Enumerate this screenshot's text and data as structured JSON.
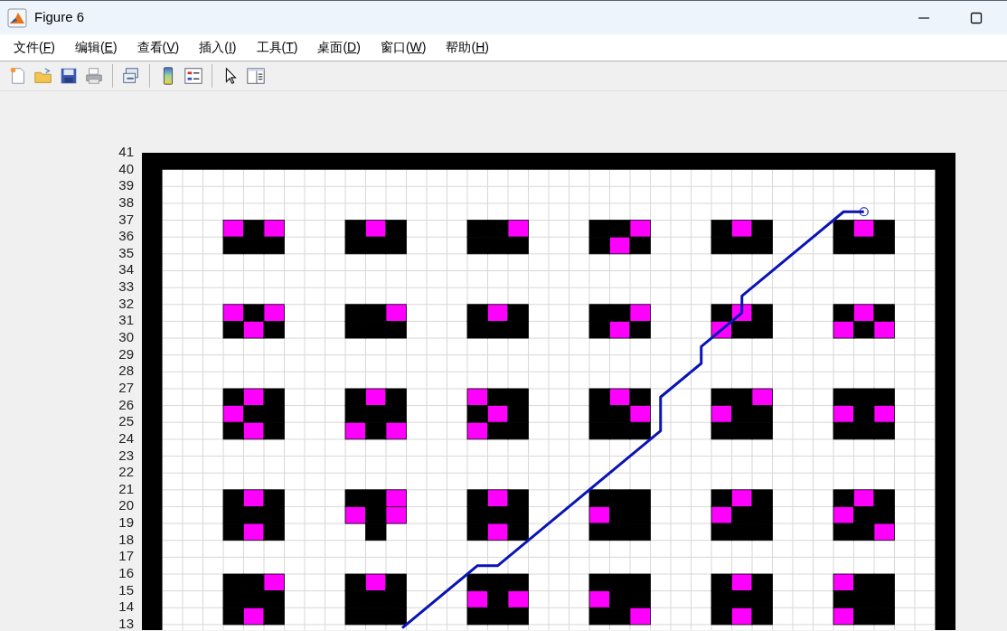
{
  "window": {
    "title": "Figure 6"
  },
  "menu": [
    {
      "label": "文件(F)"
    },
    {
      "label": "编辑(E)"
    },
    {
      "label": "查看(V)"
    },
    {
      "label": "插入(I)"
    },
    {
      "label": "工具(T)"
    },
    {
      "label": "桌面(D)"
    },
    {
      "label": "窗口(W)"
    },
    {
      "label": "帮助(H)"
    }
  ],
  "toolbar": [
    {
      "kind": "new"
    },
    {
      "kind": "open"
    },
    {
      "kind": "save"
    },
    {
      "kind": "print"
    },
    {
      "kind": "sep"
    },
    {
      "kind": "link"
    },
    {
      "kind": "sep"
    },
    {
      "kind": "colorbar"
    },
    {
      "kind": "legend"
    },
    {
      "kind": "sep"
    },
    {
      "kind": "pointer"
    },
    {
      "kind": "inspector"
    }
  ],
  "plot": {
    "y_ticks": [
      "41",
      "40",
      "39",
      "38",
      "37",
      "36",
      "35",
      "34",
      "33",
      "32",
      "31",
      "30",
      "29",
      "28",
      "27",
      "26",
      "25",
      "24",
      "23",
      "22",
      "21",
      "20",
      "19",
      "18",
      "17",
      "16",
      "15",
      "14",
      "13"
    ]
  }
}
